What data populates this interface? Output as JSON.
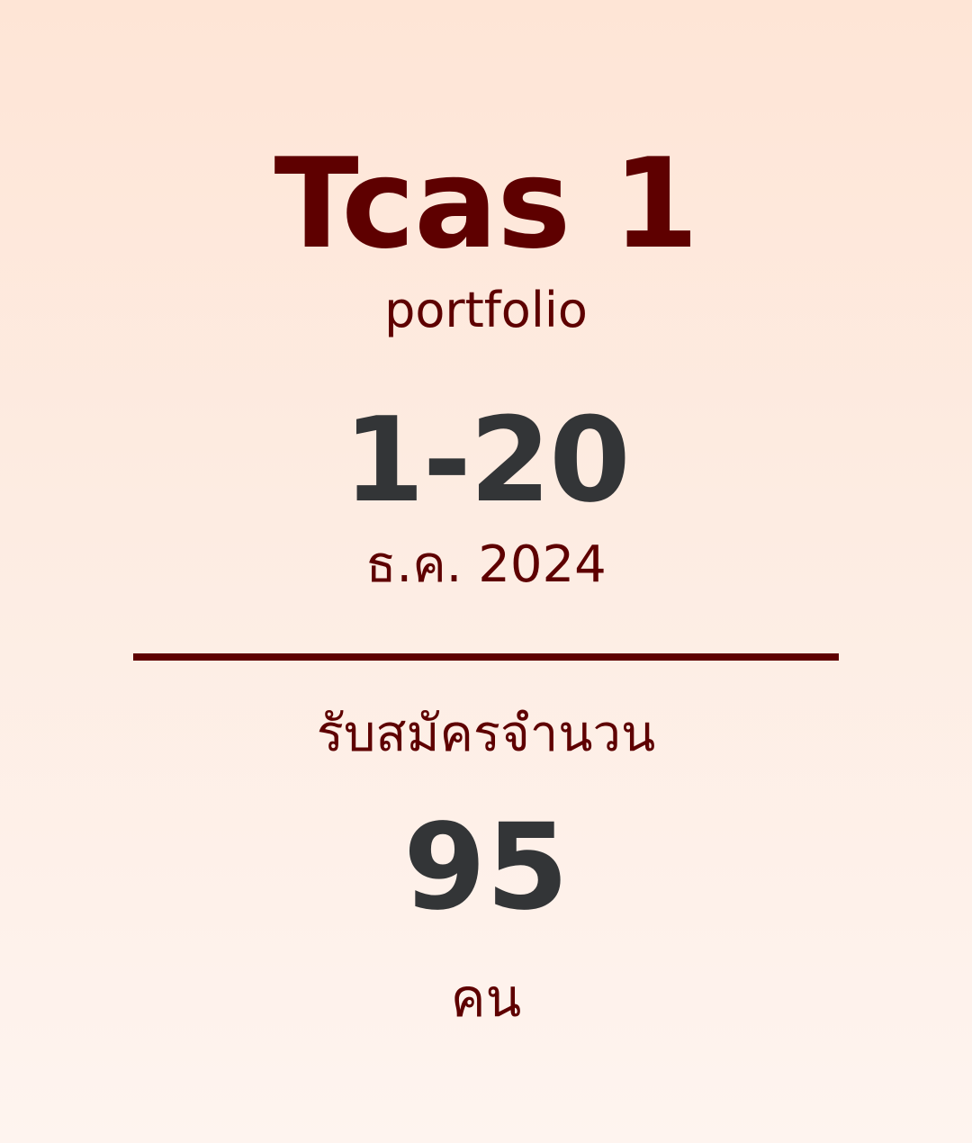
{
  "card": {
    "title": "Tcas 1",
    "subtitle": "portfolio",
    "date_range": "1-20",
    "month_year": "ธ.ค. 2024",
    "applicants_label": "รับสมัครจำนวน",
    "applicants_count": "95",
    "applicants_unit": "คน"
  },
  "colors": {
    "accent": "#5e0000",
    "number": "#333537",
    "background_top": "#fee5d6",
    "background_bottom": "#fef4ef"
  }
}
